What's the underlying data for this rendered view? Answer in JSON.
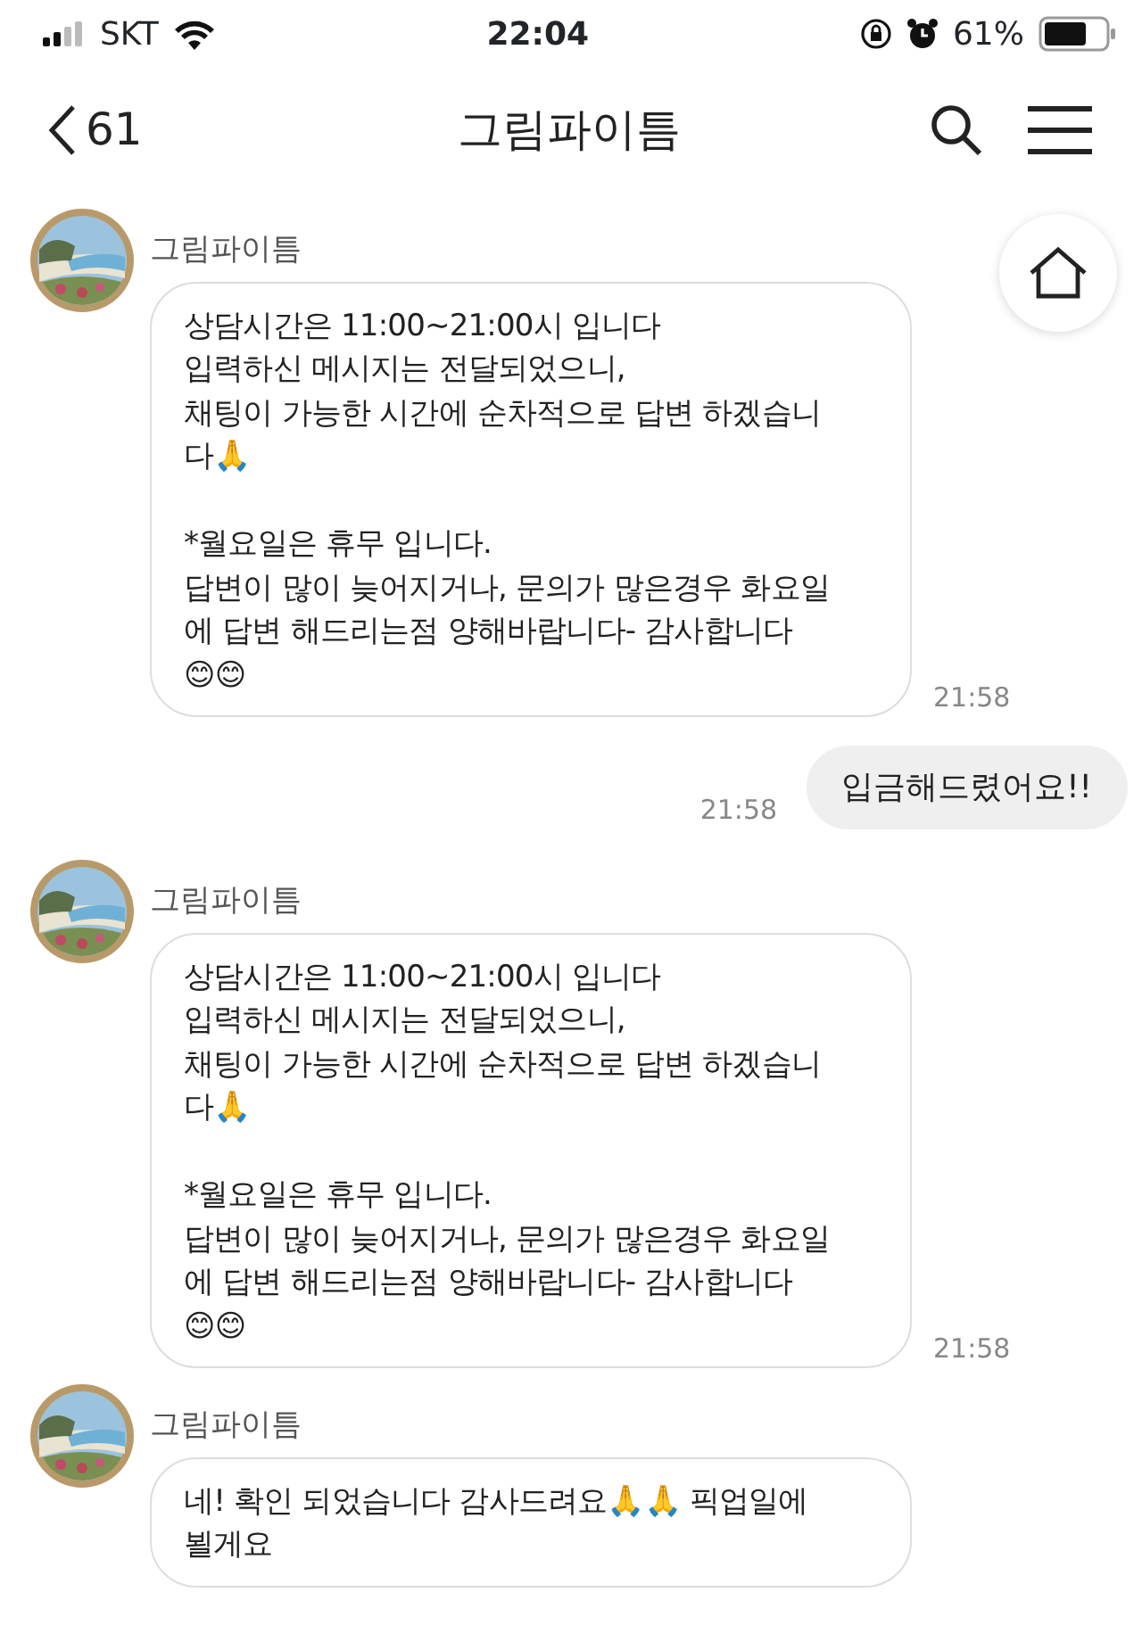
{
  "status_bar": {
    "carrier": "SKT",
    "time": "22:04",
    "battery": "61%"
  },
  "header": {
    "back_count": "61",
    "title": "그림파이틈"
  },
  "messages": [
    {
      "kind": "received",
      "sender": "그림파이틈",
      "text": "상담시간은 11:00~21:00시 입니다\n입력하신 메시지는 전달되었으니,\n채팅이 가능한 시간에 순차적으로 답변 하겠습니\n다🙏\n\n*월요일은 휴무 입니다.\n답변이 많이 늦어지거나, 문의가 많은경우 화요일\n에 답변 해드리는점 양해바랍니다- 감사합니다\n😊😊",
      "time": "21:58"
    },
    {
      "kind": "sent",
      "text": "입금해드렸어요!!",
      "time": "21:58"
    },
    {
      "kind": "received",
      "sender": "그림파이틈",
      "text": "상담시간은 11:00~21:00시 입니다\n입력하신 메시지는 전달되었으니,\n채팅이 가능한 시간에 순차적으로 답변 하겠습니\n다🙏\n\n*월요일은 휴무 입니다.\n답변이 많이 늦어지거나, 문의가 많은경우 화요일\n에 답변 해드리는점 양해바랍니다- 감사합니다\n😊😊",
      "time": "21:58"
    },
    {
      "kind": "received",
      "sender": "그림파이틈",
      "text": "네! 확인 되었습니다 감사드려요🙏🙏 픽업일에\n뵐게요"
    }
  ]
}
